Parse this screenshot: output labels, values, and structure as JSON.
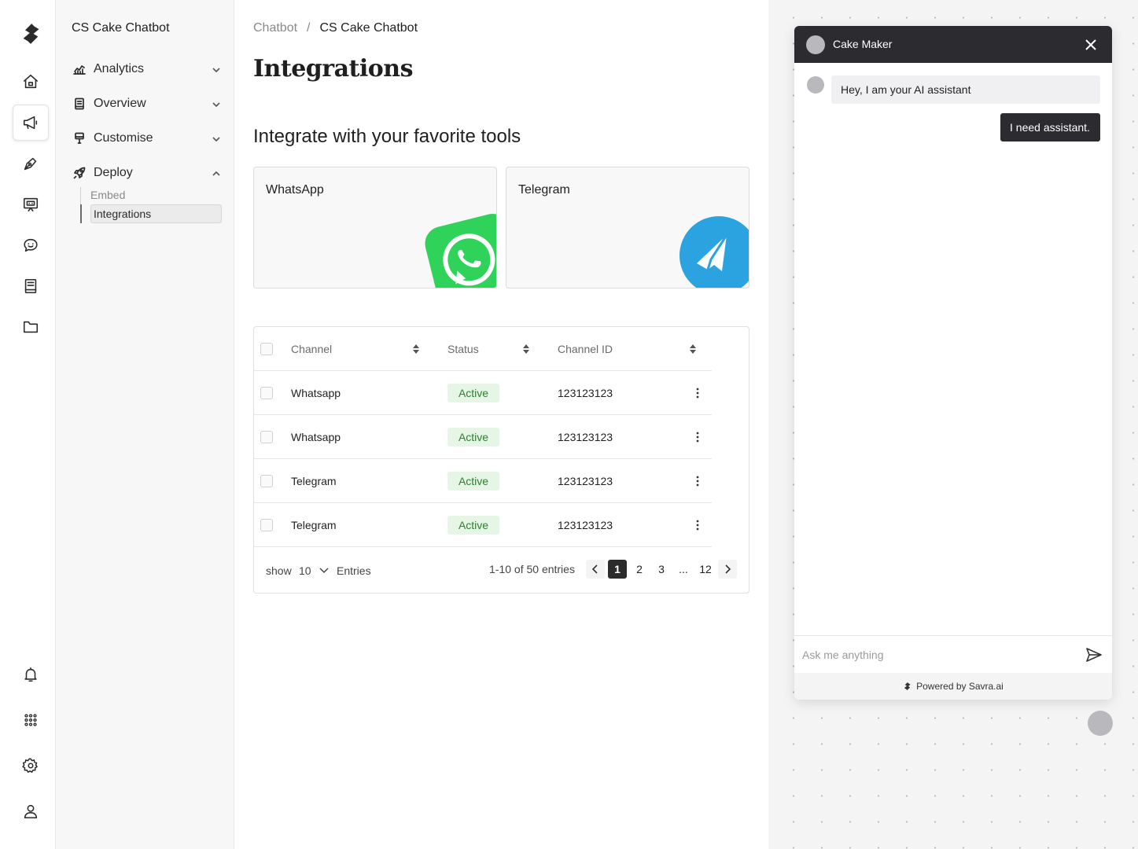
{
  "sidebar": {
    "title": "CS Cake Chatbot",
    "items": [
      {
        "label": "Analytics",
        "icon": "chart-icon"
      },
      {
        "label": "Overview",
        "icon": "document-icon"
      },
      {
        "label": "Customise",
        "icon": "brush-icon"
      },
      {
        "label": "Deploy",
        "icon": "rocket-icon"
      }
    ],
    "deploy_sub": [
      {
        "label": "Embed"
      },
      {
        "label": "Integrations"
      }
    ]
  },
  "breadcrumb": {
    "parent": "Chatbot",
    "separator": "/",
    "current": "CS Cake Chatbot"
  },
  "main": {
    "title": "Integrations",
    "section_title": "Integrate with your favorite tools",
    "cards": [
      {
        "label": "WhatsApp",
        "icon": "whatsapp-logo",
        "color": "#2fd35a"
      },
      {
        "label": "Telegram",
        "icon": "telegram-logo",
        "color": "#2aa3e0"
      }
    ]
  },
  "table": {
    "headers": {
      "channel": "Channel",
      "status": "Status",
      "channel_id": "Channel ID"
    },
    "rows": [
      {
        "channel": "Whatsapp",
        "status": "Active",
        "channel_id": "123123123"
      },
      {
        "channel": "Whatsapp",
        "status": "Active",
        "channel_id": "123123123"
      },
      {
        "channel": "Telegram",
        "status": "Active",
        "channel_id": "123123123"
      },
      {
        "channel": "Telegram",
        "status": "Active",
        "channel_id": "123123123"
      }
    ],
    "footer": {
      "show_label": "show",
      "page_size": "10",
      "entries_label": "Entries",
      "range_text": "1-10 of 50 entries",
      "pages": [
        "1",
        "2",
        "3",
        "...",
        "12"
      ],
      "current_page": "1"
    }
  },
  "chat": {
    "bot_name": "Cake Maker",
    "messages": [
      {
        "from": "bot",
        "text": "Hey, I am your AI assistant"
      },
      {
        "from": "user",
        "text": "I need assistant."
      }
    ],
    "input_placeholder": "Ask me anything",
    "powered_by": "Powered by Savra.ai"
  },
  "colors": {
    "status_active_bg": "#e6f6e6",
    "status_active_text": "#2e7d32",
    "chat_header": "#2c2c30"
  }
}
